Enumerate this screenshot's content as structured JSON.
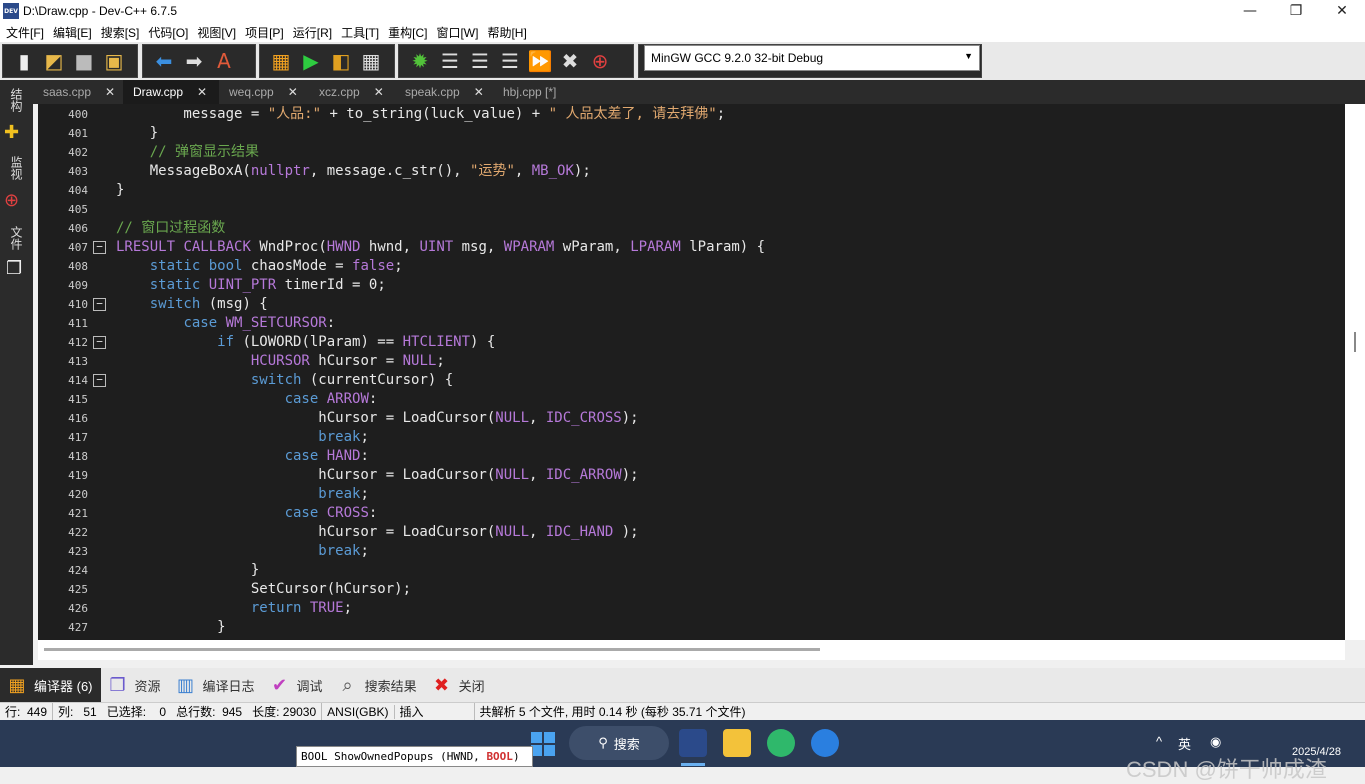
{
  "window": {
    "title": "D:\\Draw.cpp - Dev-C++ 6.7.5",
    "app_icon_text": "DEV",
    "controls": [
      "minimize-icon",
      "maximize-icon",
      "close-icon"
    ]
  },
  "menu": [
    "文件[F]",
    "编辑[E]",
    "搜索[S]",
    "代码[O]",
    "视图[V]",
    "项目[P]",
    "运行[R]",
    "工具[T]",
    "重构[C]",
    "窗口[W]",
    "帮助[H]"
  ],
  "toolbar": {
    "compiler": "MinGW GCC 9.2.0 32-bit Debug"
  },
  "left_dock": [
    "结构",
    "监视",
    "文件"
  ],
  "tabs": [
    {
      "label": "saas.cpp",
      "active": false
    },
    {
      "label": "Draw.cpp",
      "active": true
    },
    {
      "label": "weq.cpp",
      "active": false
    },
    {
      "label": "xcz.cpp",
      "active": false
    },
    {
      "label": "speak.cpp",
      "active": false
    },
    {
      "label": "hbj.cpp [*]",
      "active": false
    }
  ],
  "bottom_tabs": [
    {
      "label": "编译器 (6)",
      "icon": "compiler-grid-icon",
      "active": true
    },
    {
      "label": "资源",
      "icon": "resource-icon",
      "active": false
    },
    {
      "label": "编译日志",
      "icon": "log-chart-icon",
      "active": false
    },
    {
      "label": "调试",
      "icon": "debug-check-icon",
      "active": false
    },
    {
      "label": "搜索结果",
      "icon": "search-result-icon",
      "active": false
    },
    {
      "label": "关闭",
      "icon": "close-x-icon",
      "active": false
    }
  ],
  "status": {
    "row": "行:  449",
    "col": "列:   51",
    "sel": "已选择:    0",
    "total": "总行数:  945",
    "length": "长度: 29030",
    "encoding": "ANSI(GBK)",
    "mode": "插入",
    "parse": "共解析 5 个文件, 用时 0.14 秒 (每秒 35.71 个文件)"
  },
  "taskbar": {
    "search": "搜索",
    "watermark": "CSDN @饼干帅成渣",
    "lang": "英",
    "date": "2025/4/28"
  },
  "tooltip": {
    "prefix": "BOOL ShowOwnedPopups (HWND, ",
    "highlight": "BOOL",
    "suffix": ")"
  },
  "code_lines": [
    {
      "n": "400",
      "fold": "",
      "t": "        message = \"人品:\" + to_string(luck_value) + \" 人品太差了, 请去拜佛\";"
    },
    {
      "n": "401",
      "fold": "",
      "t": "    }"
    },
    {
      "n": "402",
      "fold": "",
      "t": "    // 弹窗显示结果"
    },
    {
      "n": "403",
      "fold": "",
      "t": "    MessageBoxA(nullptr, message.c_str(), \"运势\", MB_OK);"
    },
    {
      "n": "404",
      "fold": "",
      "t": "}"
    },
    {
      "n": "405",
      "fold": "",
      "t": ""
    },
    {
      "n": "406",
      "fold": "",
      "t": "// 窗口过程函数"
    },
    {
      "n": "407",
      "fold": "-",
      "t": "LRESULT CALLBACK WndProc(HWND hwnd, UINT msg, WPARAM wParam, LPARAM lParam) {"
    },
    {
      "n": "408",
      "fold": "",
      "t": "    static bool chaosMode = false;"
    },
    {
      "n": "409",
      "fold": "",
      "t": "    static UINT_PTR timerId = 0;"
    },
    {
      "n": "410",
      "fold": "-",
      "t": "    switch (msg) {"
    },
    {
      "n": "411",
      "fold": "",
      "t": "        case WM_SETCURSOR:"
    },
    {
      "n": "412",
      "fold": "-",
      "t": "            if (LOWORD(lParam) == HTCLIENT) {"
    },
    {
      "n": "413",
      "fold": "",
      "t": "                HCURSOR hCursor = NULL;"
    },
    {
      "n": "414",
      "fold": "-",
      "t": "                switch (currentCursor) {"
    },
    {
      "n": "415",
      "fold": "",
      "t": "                    case ARROW:"
    },
    {
      "n": "416",
      "fold": "",
      "t": "                        hCursor = LoadCursor(NULL, IDC_CROSS);"
    },
    {
      "n": "417",
      "fold": "",
      "t": "                        break;"
    },
    {
      "n": "418",
      "fold": "",
      "t": "                    case HAND:"
    },
    {
      "n": "419",
      "fold": "",
      "t": "                        hCursor = LoadCursor(NULL, IDC_ARROW);"
    },
    {
      "n": "420",
      "fold": "",
      "t": "                        break;"
    },
    {
      "n": "421",
      "fold": "",
      "t": "                    case CROSS:"
    },
    {
      "n": "422",
      "fold": "",
      "t": "                        hCursor = LoadCursor(NULL, IDC_HAND );"
    },
    {
      "n": "423",
      "fold": "",
      "t": "                        break;"
    },
    {
      "n": "424",
      "fold": "",
      "t": "                }"
    },
    {
      "n": "425",
      "fold": "",
      "t": "                SetCursor(hCursor);"
    },
    {
      "n": "426",
      "fold": "",
      "t": "                return TRUE;"
    },
    {
      "n": "427",
      "fold": "",
      "t": "            }"
    }
  ],
  "colors": {
    "editor_bg": "#1e1e1e",
    "keyword": "#5b9bd5",
    "type": "#b679d9",
    "string": "#e0a86f",
    "comment": "#6aa84f"
  }
}
